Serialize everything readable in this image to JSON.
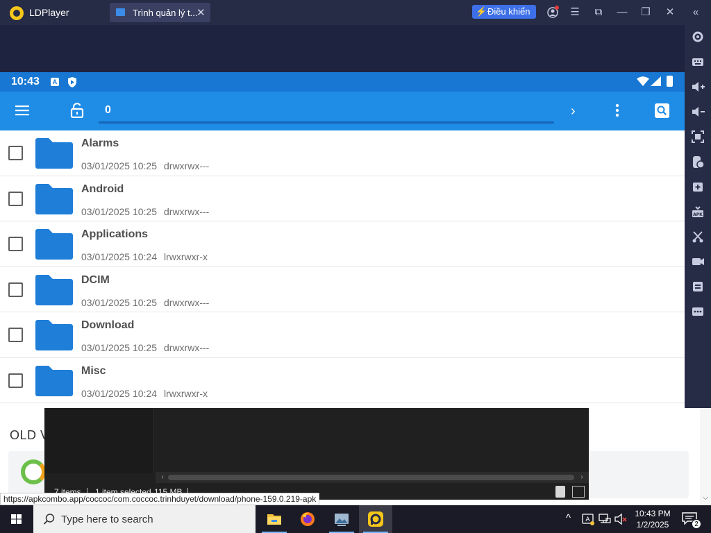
{
  "ldplayer": {
    "app_name": "LDPlayer",
    "tab_label": "Trình quản lý t...",
    "tab_close": "✕",
    "control_label": "Điều khiển",
    "accent_color": "#3d70e8",
    "window_controls": {
      "menu": "☰",
      "fullscreen": "⧉",
      "minimize": "—",
      "restore": "❐",
      "close": "✕",
      "collapse": "«"
    },
    "sidebar_icons": [
      "settings-icon",
      "keyboard-icon",
      "volume-up-icon",
      "volume-down-icon",
      "screenshot-icon",
      "shake-icon",
      "add-window-icon",
      "apk-install-icon",
      "scissors-icon",
      "record-video-icon",
      "sync-icon",
      "more-icon"
    ]
  },
  "android": {
    "status_bar": {
      "time": "10:43",
      "a_icon": "A",
      "color": "#1877d3"
    },
    "toolbar": {
      "path": "0",
      "forward": "›",
      "color": "#1f8ce6"
    },
    "files": [
      {
        "name": "Alarms",
        "date": "03/01/2025 10:25",
        "perm": "drwxrwx---"
      },
      {
        "name": "Android",
        "date": "03/01/2025 10:25",
        "perm": "drwxrwx---"
      },
      {
        "name": "Applications",
        "date": "03/01/2025 10:24",
        "perm": "lrwxrwxr-x"
      },
      {
        "name": "DCIM",
        "date": "03/01/2025 10:25",
        "perm": "drwxrwx---"
      },
      {
        "name": "Download",
        "date": "03/01/2025 10:25",
        "perm": "drwxrwx---"
      },
      {
        "name": "Misc",
        "date": "03/01/2025 10:24",
        "perm": "lrwxrwxr-x"
      }
    ],
    "folder_color": "#1e7ed8"
  },
  "background_page": {
    "old_label": "OLD V"
  },
  "explorer": {
    "items_count": "7 items",
    "selected": "1 item selected",
    "size": "115 MB",
    "scroll_left": "‹",
    "scroll_right": "›"
  },
  "url_status": "https://apkcombo.app/coccoc/com.coccoc.trinhduyet/download/phone-159.0.219-apk",
  "taskbar": {
    "search_placeholder": "Type here to search",
    "time": "10:43 PM",
    "date": "1/2/2025",
    "notification_count": "2",
    "tray_up": "^",
    "apps": [
      "file-explorer-icon",
      "firefox-icon",
      "photos-icon",
      "ldplayer-icon"
    ]
  }
}
